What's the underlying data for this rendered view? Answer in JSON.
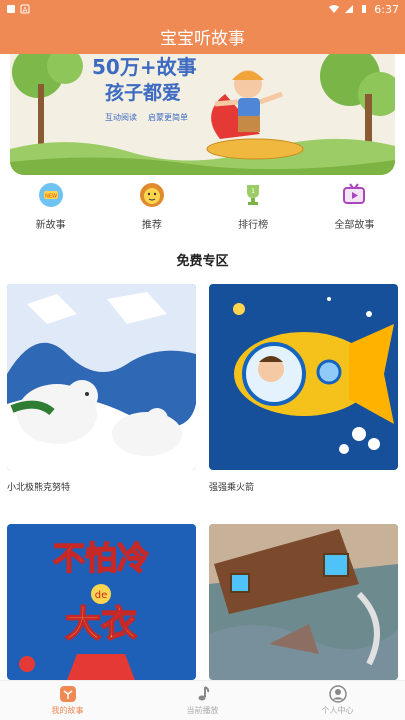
{
  "status_bar": {
    "left_icons": [
      "app-icon",
      "a-icon"
    ],
    "time": "6:37",
    "right_icons": [
      "wifi-icon",
      "signal-icon",
      "battery-icon"
    ]
  },
  "app_bar": {
    "title": "宝宝听故事"
  },
  "banner": {
    "headline_top": "50万+故事",
    "headline_bottom": "孩子都爱",
    "tag_left": "互动阅读",
    "tag_right": "启蒙更简单"
  },
  "nav": [
    {
      "label": "新故事",
      "icon": "new-story-icon"
    },
    {
      "label": "推荐",
      "icon": "lion-icon"
    },
    {
      "label": "排行榜",
      "icon": "trophy-icon"
    },
    {
      "label": "全部故事",
      "icon": "tv-play-icon"
    }
  ],
  "section": {
    "title": "免费专区"
  },
  "cards": [
    {
      "title": "小北极熊克努特"
    },
    {
      "title": "强强乘火箭"
    },
    {
      "title": "",
      "cover_line1": "不怕冷",
      "cover_small": "de",
      "cover_line2": "大衣"
    },
    {
      "title": ""
    }
  ],
  "tabs": [
    {
      "label": "我的故事",
      "icon": "story-book-icon",
      "active": true
    },
    {
      "label": "当前播放",
      "icon": "music-note-icon",
      "active": false
    },
    {
      "label": "个人中心",
      "icon": "person-icon",
      "active": false
    }
  ],
  "colors": {
    "accent": "#f08a55",
    "header": "#f08a55"
  }
}
